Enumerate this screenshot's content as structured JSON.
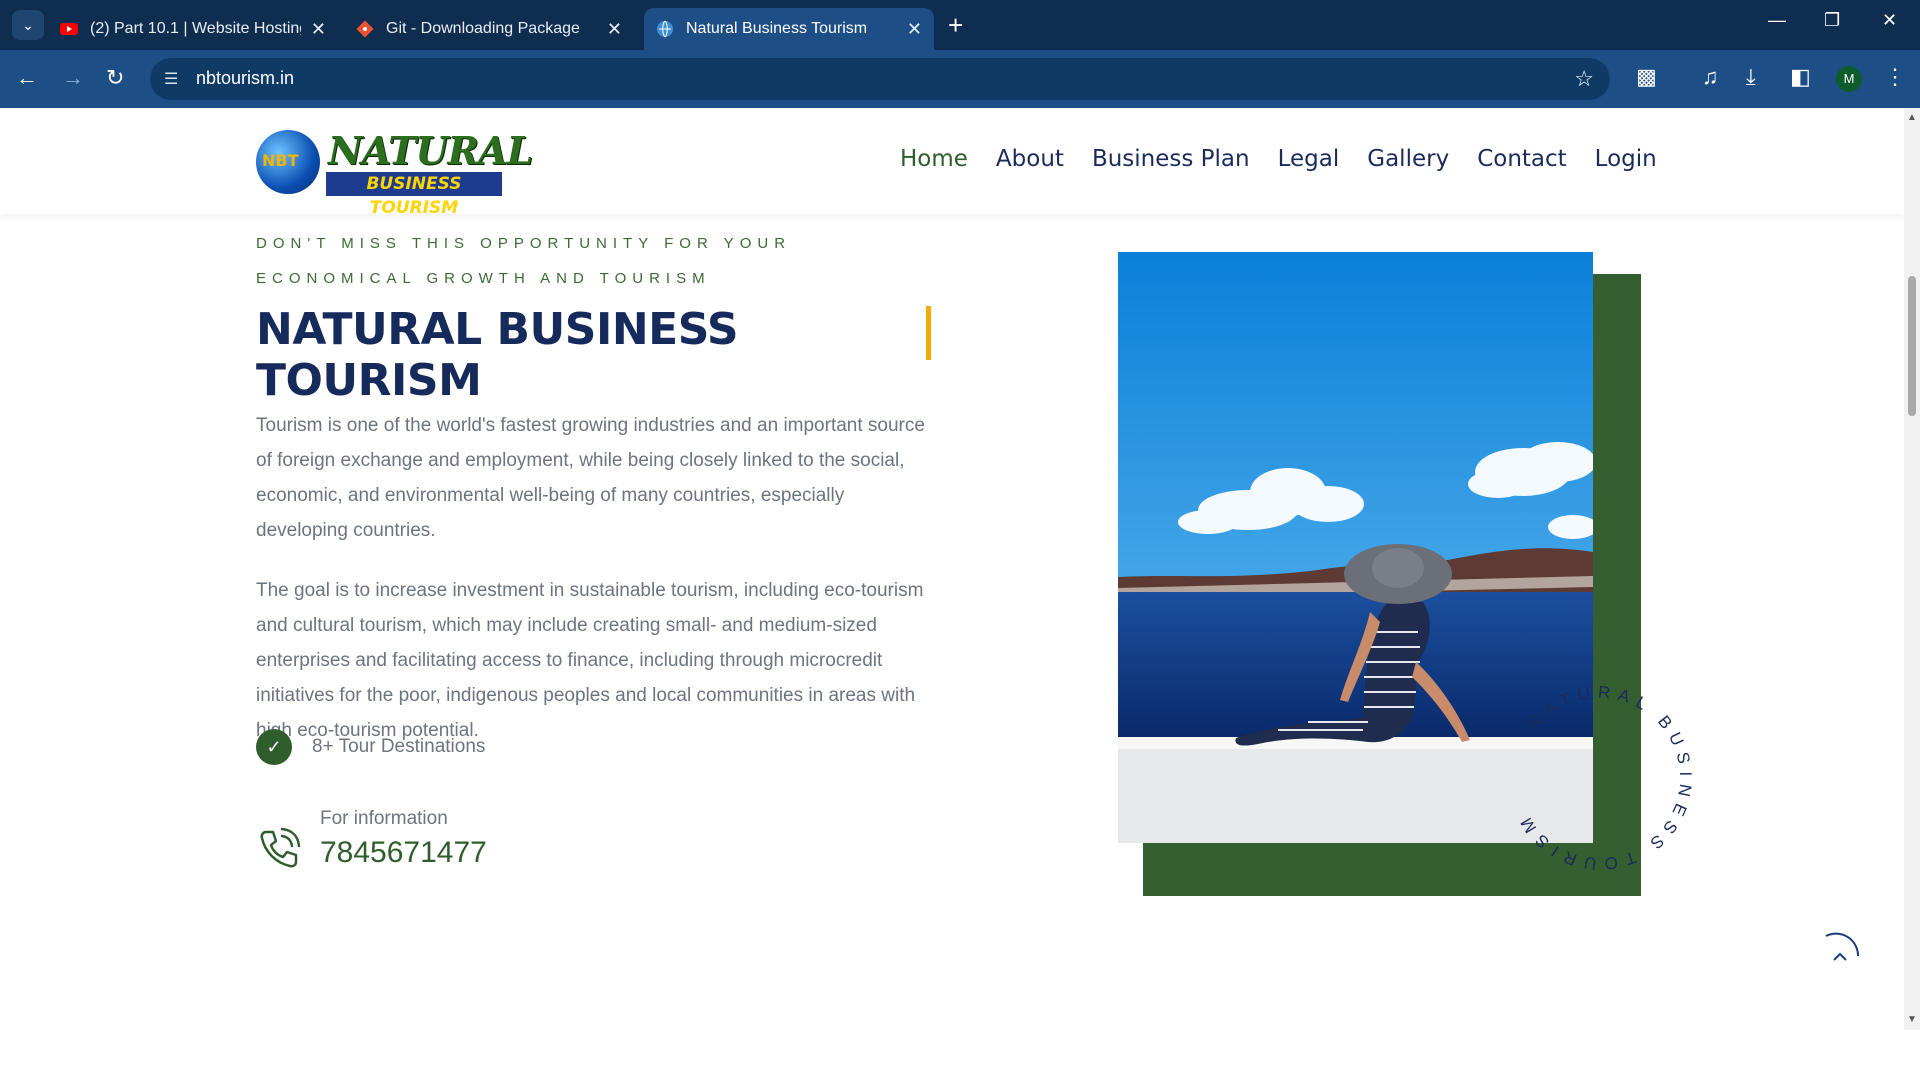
{
  "browser": {
    "tabs": [
      {
        "title": "(2) Part 10.1 | Website Hosting |",
        "favicon": "youtube-icon",
        "active": false
      },
      {
        "title": "Git - Downloading Package",
        "favicon": "git-icon",
        "active": false
      },
      {
        "title": "Natural Business Tourism",
        "favicon": "globe-icon",
        "active": true
      }
    ],
    "url": "nbtourism.in",
    "profile_initial": "M"
  },
  "site": {
    "logo": {
      "top": "NATURAL",
      "bottom": "BUSINESS TOURISM",
      "badge": "NBT"
    },
    "menu": [
      "Home",
      "About",
      "Business Plan",
      "Legal",
      "Gallery",
      "Contact",
      "Login"
    ],
    "active_menu": "Home"
  },
  "hero": {
    "kicker_line1": "DON'T MISS THIS OPPORTUNITY FOR YOUR",
    "kicker_line2": "ECONOMICAL GROWTH AND TOURISM",
    "heading": "NATURAL BUSINESS TOURISM",
    "paragraph1": "Tourism is one of the world's fastest growing industries and an important source of foreign exchange and employment, while being closely linked to the social, economic, and environmental well-being of many countries, especially developing countries.",
    "paragraph2": "The goal is to increase investment in sustainable tourism, including eco-tourism and cultural tourism, which may include creating small- and medium-sized enterprises and facilitating access to finance, including through microcredit initiatives for the poor, indigenous peoples and local communities in areas with high eco-tourism potential.",
    "feature": "8+ Tour Destinations",
    "info_label": "For information",
    "phone": "7845671477",
    "circle_text": "NATURAL BUSINESS TOURISM"
  },
  "colors": {
    "primary_green": "#2f5e2c",
    "navy": "#172a5c",
    "accent": "#f5a800"
  }
}
